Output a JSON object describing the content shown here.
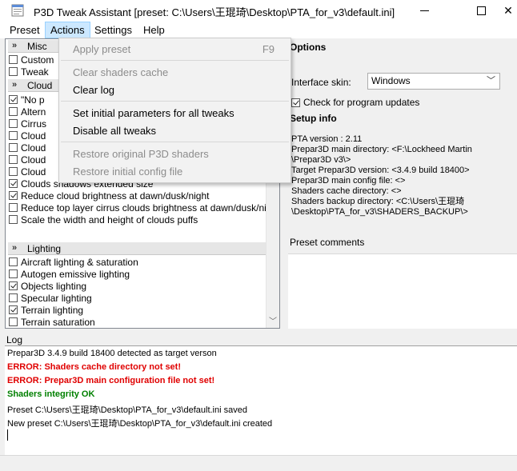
{
  "window": {
    "title": "P3D Tweak Assistant [preset: C:\\Users\\王琨琦\\Desktop\\PTA_for_v3\\default.ini]"
  },
  "menubar": {
    "items": [
      "Preset",
      "Actions",
      "Settings",
      "Help"
    ],
    "active": "Actions"
  },
  "actions_menu": {
    "items": [
      {
        "label": "Apply preset",
        "shortcut": "F9",
        "enabled": false
      },
      {
        "label": "Clear shaders cache",
        "enabled": false
      },
      {
        "label": "Clear log",
        "enabled": true
      },
      {
        "label": "Set initial parameters for all tweaks",
        "enabled": true
      },
      {
        "label": "Disable all tweaks",
        "enabled": true
      },
      {
        "label": "Restore original P3D shaders",
        "enabled": false
      },
      {
        "label": "Restore initial config file",
        "enabled": false
      }
    ]
  },
  "tweaks": {
    "groups": [
      {
        "label": "Misc",
        "chevron": "»"
      },
      {
        "label": "Cloud",
        "chevron": "»"
      },
      {
        "label": "Lighting",
        "chevron": "»"
      }
    ],
    "rows": [
      {
        "label": "Custom",
        "checked": false
      },
      {
        "label": "Tweak",
        "checked": false
      },
      {
        "label": "\"No p",
        "checked": true
      },
      {
        "label": "Altern",
        "checked": false
      },
      {
        "label": "Cirrus",
        "checked": false
      },
      {
        "label": "Cloud",
        "checked": false
      },
      {
        "label": "Cloud",
        "checked": false
      },
      {
        "label": "Cloud",
        "checked": false
      },
      {
        "label": "Cloud",
        "checked": false
      },
      {
        "label": "Clouds shadows extended size",
        "checked": true
      },
      {
        "label": "Reduce cloud brightness at dawn/dusk/night",
        "checked": true
      },
      {
        "label": "Reduce top layer cirrus clouds brightness at dawn/dusk/ni",
        "checked": false
      },
      {
        "label": "Scale the width and height of clouds puffs",
        "checked": false
      },
      {
        "label": "Aircraft lighting & saturation",
        "checked": false
      },
      {
        "label": "Autogen emissive lighting",
        "checked": false
      },
      {
        "label": "Objects lighting",
        "checked": true
      },
      {
        "label": "Specular lighting",
        "checked": false
      },
      {
        "label": "Terrain lighting",
        "checked": true
      },
      {
        "label": "Terrain saturation",
        "checked": false
      }
    ]
  },
  "options": {
    "title": "Options",
    "skin_label": "Interface skin:",
    "skin_value": "Windows",
    "check_updates_label": "Check for program updates",
    "check_updates": true
  },
  "setup_info": {
    "title": "Setup info",
    "lines": [
      "PTA version : 2.11",
      "Prepar3D main directory: <F:\\Lockheed Martin",
      "\\Prepar3D v3\\>",
      "Target Prepar3D version: <3.4.9 build 18400>",
      "Prepar3D main config file: <>",
      "Shaders cache directory: <>",
      "Shaders backup directory: <C:\\Users\\王琨琦",
      "\\Desktop\\PTA_for_v3\\SHADERS_BACKUP\\>"
    ]
  },
  "preset_comments": {
    "title": "Preset comments"
  },
  "log": {
    "title": "Log",
    "lines": [
      {
        "text": "Prepar3D 3.4.9 build 18400 detected as target verson",
        "kind": "info"
      },
      {
        "text": "ERROR: Shaders cache directory not set!",
        "kind": "error"
      },
      {
        "text": "ERROR: Prepar3D main configuration file not set!",
        "kind": "error"
      },
      {
        "text": "Shaders integrity OK",
        "kind": "ok"
      },
      {
        "text": "Preset C:\\Users\\王琨琦\\Desktop\\PTA_for_v3\\default.ini saved",
        "kind": "info"
      },
      {
        "text": "New preset C:\\Users\\王琨琦\\Desktop\\PTA_for_v3\\default.ini created",
        "kind": "info"
      }
    ]
  },
  "colors": {
    "error": "#e00000",
    "ok": "#008000",
    "menu_highlight": "#cce8ff"
  }
}
